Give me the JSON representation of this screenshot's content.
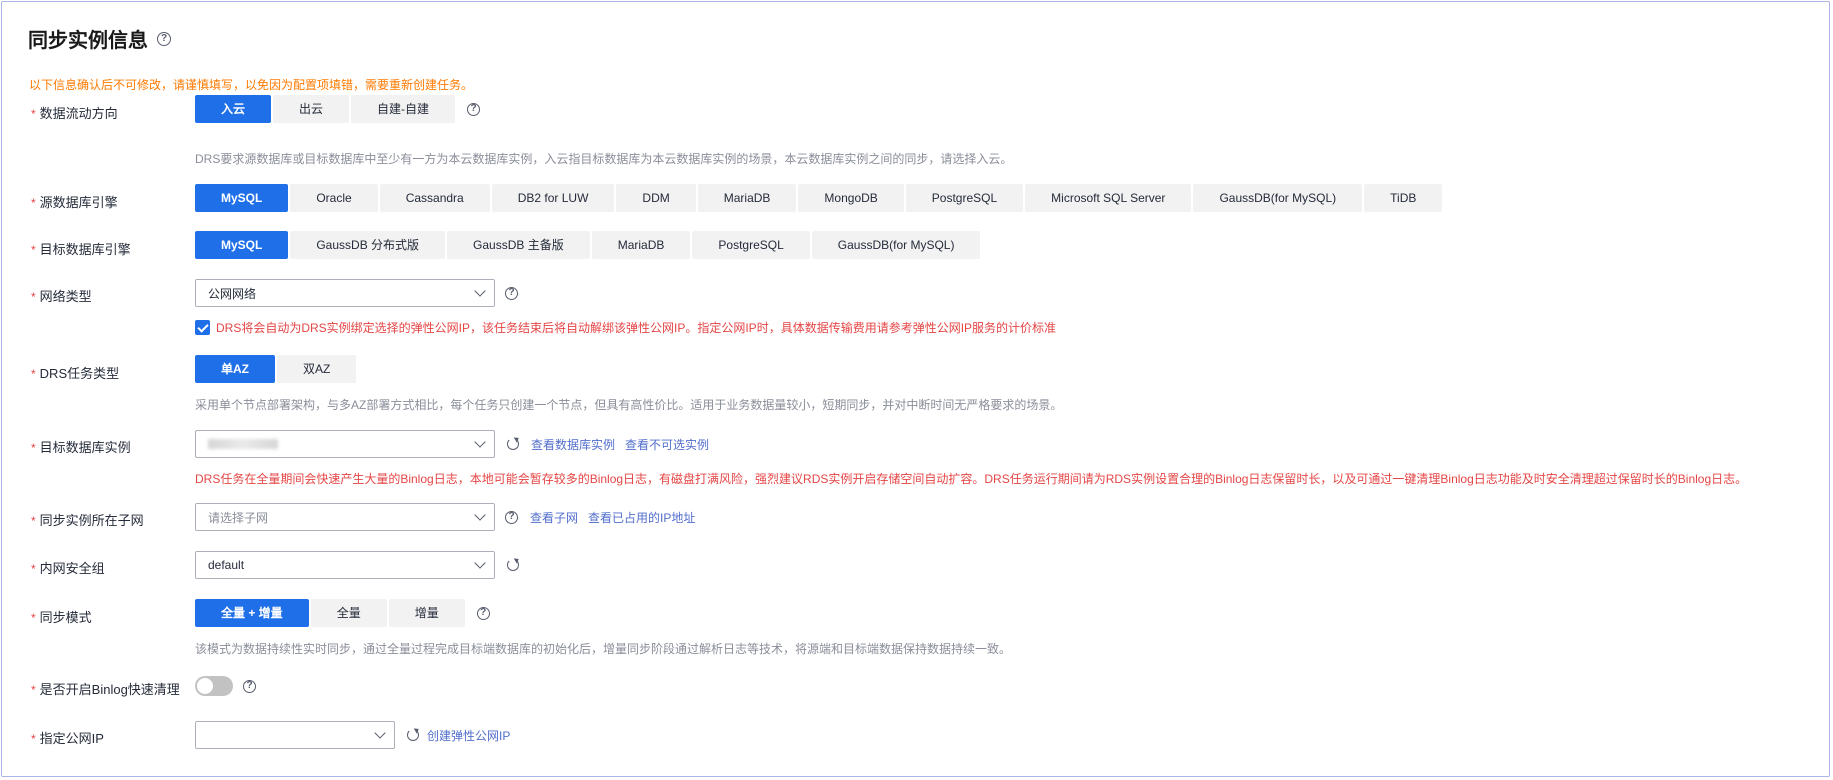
{
  "title": "同步实例信息",
  "warning": "以下信息确认后不可修改，请谨慎填写，以免因为配置项填错，需要重新创建任务。",
  "flow": {
    "label": "数据流动方向",
    "options": [
      "入云",
      "出云",
      "自建-自建"
    ],
    "hint": "DRS要求源数据库或目标数据库中至少有一方为本云数据库实例，入云指目标数据库为本云数据库实例的场景，本云数据库实例之间的同步，请选择入云。"
  },
  "source_engine": {
    "label": "源数据库引擎",
    "options": [
      "MySQL",
      "Oracle",
      "Cassandra",
      "DB2 for LUW",
      "DDM",
      "MariaDB",
      "MongoDB",
      "PostgreSQL",
      "Microsoft SQL Server",
      "GaussDB(for MySQL)",
      "TiDB"
    ]
  },
  "target_engine": {
    "label": "目标数据库引擎",
    "options": [
      "MySQL",
      "GaussDB 分布式版",
      "GaussDB 主备版",
      "MariaDB",
      "PostgreSQL",
      "GaussDB(for MySQL)"
    ]
  },
  "network": {
    "label": "网络类型",
    "value": "公网网络",
    "check_text": "DRS将会自动为DRS实例绑定选择的弹性公网IP，该任务结束后将自动解绑该弹性公网IP。指定公网IP时，具体数据传输费用请参考弹性公网IP服务的计价标准"
  },
  "task_type": {
    "label": "DRS任务类型",
    "options": [
      "单AZ",
      "双AZ"
    ],
    "hint": "采用单个节点部署架构，与多AZ部署方式相比，每个任务只创建一个节点，但具有高性价比。适用于业务数据量较小，短期同步，并对中断时间无严格要求的场景。"
  },
  "target_instance": {
    "label": "目标数据库实例",
    "link1": "查看数据库实例",
    "link2": "查看不可选实例",
    "warn": "DRS任务在全量期间会快速产生大量的Binlog日志，本地可能会暂存较多的Binlog日志，有磁盘打满风险，强烈建议RDS实例开启存储空间自动扩容。DRS任务运行期间请为RDS实例设置合理的Binlog日志保留时长，以及可通过一键清理Binlog日志功能及时安全清理超过保留时长的Binlog日志。"
  },
  "subnet": {
    "label": "同步实例所在子网",
    "placeholder": "请选择子网",
    "link1": "查看子网",
    "link2": "查看已占用的IP地址"
  },
  "security_group": {
    "label": "内网安全组",
    "value": "default"
  },
  "sync_mode": {
    "label": "同步模式",
    "options": [
      "全量 + 增量",
      "全量",
      "增量"
    ],
    "hint": "该模式为数据持续性实时同步，通过全量过程完成目标端数据库的初始化后，增量同步阶段通过解析日志等技术，将源端和目标端数据保持数据持续一致。"
  },
  "binlog": {
    "label": "是否开启Binlog快速清理",
    "enabled": false
  },
  "public_ip": {
    "label": "指定公网IP",
    "value": "",
    "link": "创建弹性公网IP"
  },
  "colors": {
    "primary": "#1f6fe8",
    "warning": "#ff7a00",
    "error": "#e54545",
    "link": "#526ecc"
  }
}
